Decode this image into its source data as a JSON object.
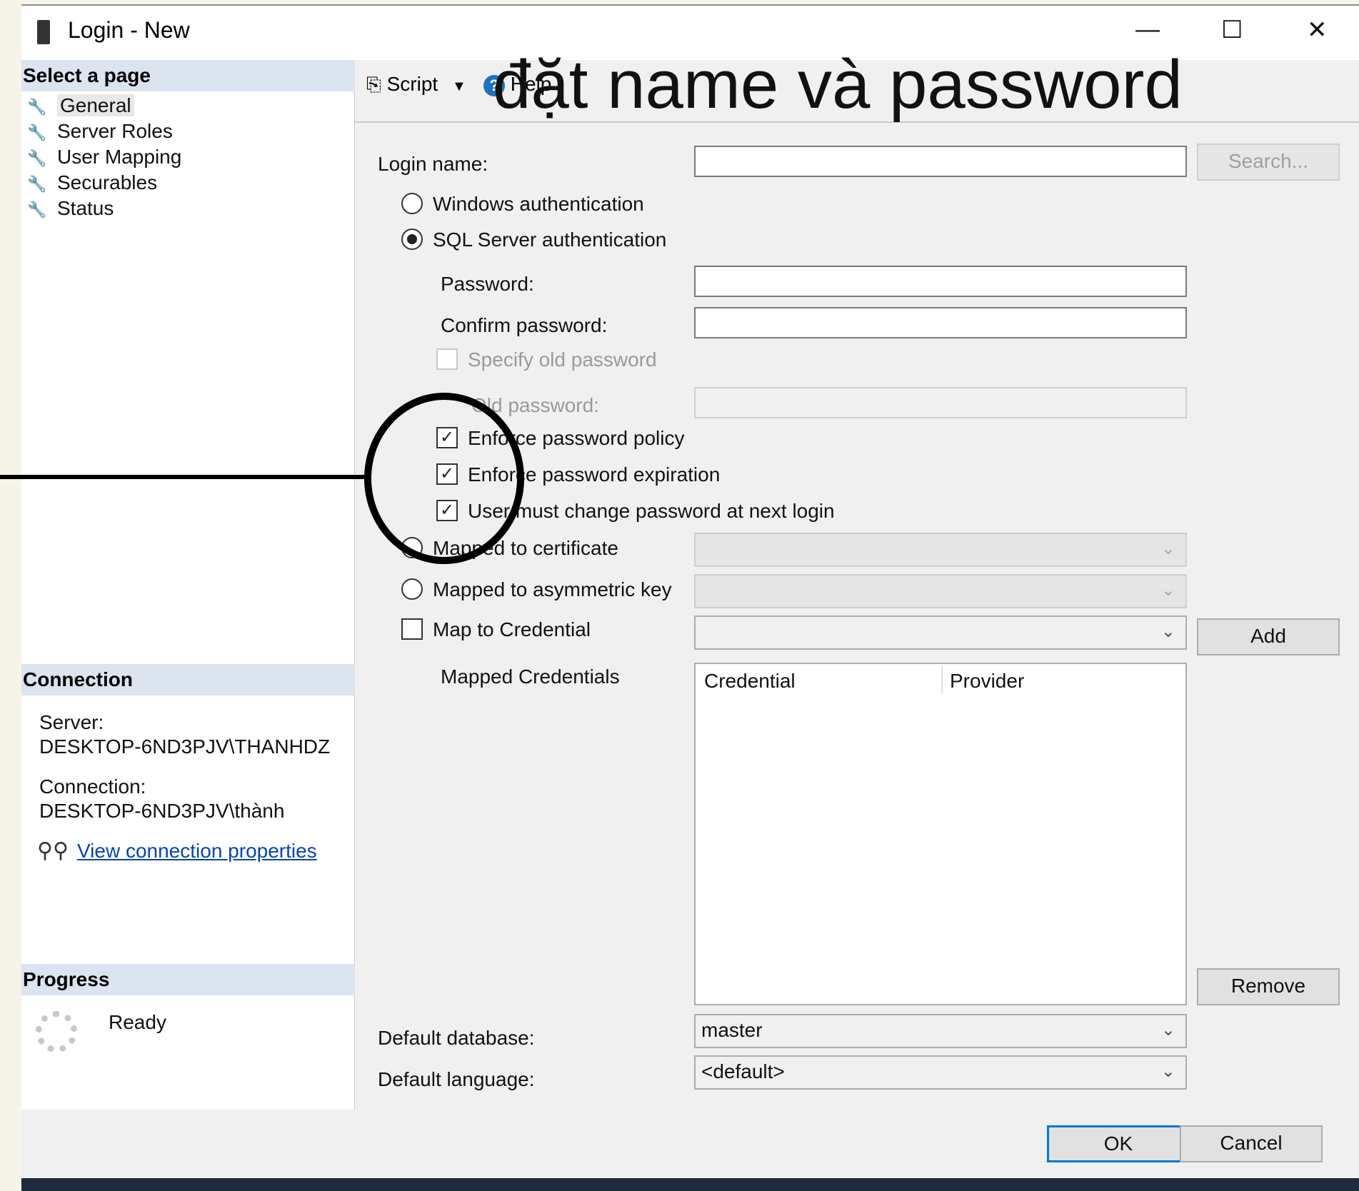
{
  "window": {
    "title": "Login - New",
    "buttons": {
      "minimize": "—",
      "maximize": "☐",
      "close": "✕"
    }
  },
  "annotation": {
    "overlay_text": "đặt name và password"
  },
  "left_panel": {
    "select_page_header": "Select a page",
    "nav_items": [
      {
        "label": "General",
        "icon": "wrench-icon",
        "selected": true
      },
      {
        "label": "Server Roles",
        "icon": "wrench-icon"
      },
      {
        "label": "User Mapping",
        "icon": "wrench-icon"
      },
      {
        "label": "Securables",
        "icon": "wrench-icon"
      },
      {
        "label": "Status",
        "icon": "wrench-icon"
      }
    ],
    "connection": {
      "header": "Connection",
      "server_label": "Server:",
      "server_value": "DESKTOP-6ND3PJV\\THANHDZ",
      "connection_label": "Connection:",
      "connection_value": "DESKTOP-6ND3PJV\\thành",
      "view_link": "View connection properties"
    },
    "progress": {
      "header": "Progress",
      "status": "Ready"
    }
  },
  "toolbar": {
    "script_label": "Script",
    "help_label": "Help"
  },
  "form": {
    "login_name_label": "Login name:",
    "login_name_value": "",
    "search_button": "Search...",
    "windows_auth": "Windows authentication",
    "sql_auth": "SQL Server authentication",
    "password_label": "Password:",
    "confirm_password_label": "Confirm password:",
    "specify_old_password": "Specify old password",
    "old_password_label": "Old password:",
    "enforce_policy": "Enforce password policy",
    "enforce_expiration": "Enforce password expiration",
    "must_change": "User must change password at next login",
    "mapped_certificate": "Mapped to certificate",
    "mapped_asym_key": "Mapped to asymmetric key",
    "map_credential": "Map to Credential",
    "add_button": "Add",
    "mapped_credentials_label": "Mapped Credentials",
    "grid_columns": [
      "Credential",
      "Provider"
    ],
    "remove_button": "Remove",
    "default_database_label": "Default database:",
    "default_database_value": "master",
    "default_language_label": "Default language:",
    "default_language_value": "<default>"
  },
  "footer": {
    "ok": "OK",
    "cancel": "Cancel"
  }
}
